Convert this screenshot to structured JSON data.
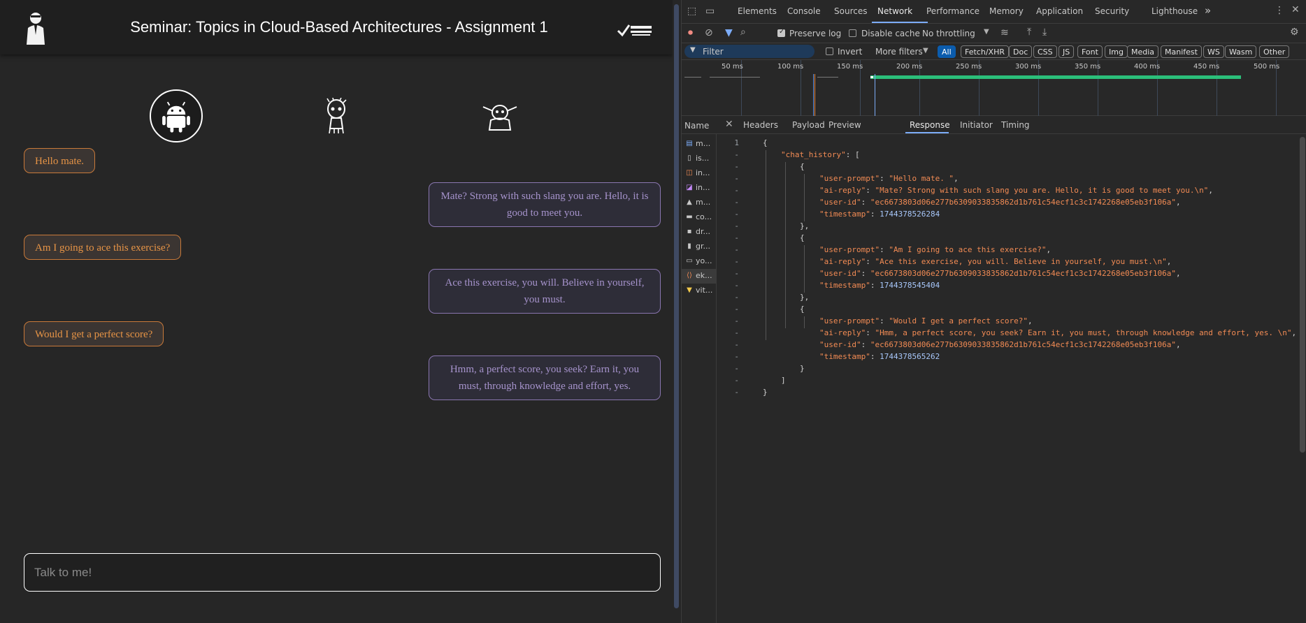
{
  "app": {
    "title": "Seminar: Topics in Cloud-Based Architectures - Assignment 1",
    "avatars": [
      "android-icon",
      "groot-icon",
      "yoda-icon"
    ],
    "messages": [
      {
        "role": "user",
        "text": "Hello mate."
      },
      {
        "role": "ai",
        "text": "Mate? Strong with such slang you are. Hello, it is good to meet you."
      },
      {
        "role": "user",
        "text": "Am I going to ace this exercise?"
      },
      {
        "role": "ai",
        "text": "Ace this exercise, you will. Believe in yourself, you must."
      },
      {
        "role": "user",
        "text": "Would I get a perfect score?"
      },
      {
        "role": "ai",
        "text": "Hmm, a perfect score, you seek? Earn it, you must, through knowledge and effort, yes."
      }
    ],
    "input_placeholder": "Talk to me!",
    "colors": {
      "user_text": "#e79446",
      "ai_text": "#a693cc",
      "background": "#262626"
    }
  },
  "devtools": {
    "tabs": [
      "Elements",
      "Console",
      "Sources",
      "Network",
      "Performance",
      "Memory",
      "Application",
      "Security",
      "Lighthouse"
    ],
    "active_tab": "Network",
    "more_tabs": "»",
    "toolbar": {
      "preserve_log": "Preserve log",
      "disable_cache": "Disable cache",
      "throttling": "No throttling"
    },
    "filterbar": {
      "filter_placeholder": "Filter",
      "invert": "Invert",
      "more_filters": "More filters",
      "types": [
        "All",
        "Fetch/XHR",
        "Doc",
        "CSS",
        "JS",
        "Font",
        "Img",
        "Media",
        "Manifest",
        "WS",
        "Wasm",
        "Other"
      ]
    },
    "timeline_ticks": [
      "50 ms",
      "100 ms",
      "150 ms",
      "200 ms",
      "250 ms",
      "300 ms",
      "350 ms",
      "400 ms",
      "450 ms",
      "500 ms"
    ],
    "name_header": "Name",
    "requests": [
      "m...",
      "is...",
      "in...",
      "in...",
      "m...",
      "co...",
      "dr...",
      "gr...",
      "yo...",
      "ek...",
      "vit..."
    ],
    "detail_tabs": [
      "Headers",
      "Payload",
      "Preview",
      "Response",
      "Initiator",
      "Timing"
    ],
    "active_detail_tab": "Response",
    "response": {
      "line_number": "1",
      "gutter_dash": "-",
      "key_chat_history": "\"chat_history\"",
      "entries": [
        {
          "user_prompt": "\"Hello mate. \"",
          "ai_reply": "\"Mate? Strong with such slang you are. Hello, it is good to meet you.\\n\"",
          "user_id": "\"ec6673803d06e277b6309033835862d1b761c54ecf1c3c1742268e05eb3f106a\"",
          "timestamp": "1744378526284"
        },
        {
          "user_prompt": "\"Am I going to ace this exercise?\"",
          "ai_reply": "\"Ace this exercise, you will. Believe in yourself, you must.\\n\"",
          "user_id": "\"ec6673803d06e277b6309033835862d1b761c54ecf1c3c1742268e05eb3f106a\"",
          "timestamp": "1744378545404"
        },
        {
          "user_prompt": "\"Would I get a perfect score?\"",
          "ai_reply": "\"Hmm, a perfect score, you seek? Earn it, you must, through knowledge and effort, yes. \\n\"",
          "user_id": "\"ec6673803d06e277b6309033835862d1b761c54ecf1c3c1742268e05eb3f106a\"",
          "timestamp": "1744378565262"
        }
      ]
    }
  }
}
